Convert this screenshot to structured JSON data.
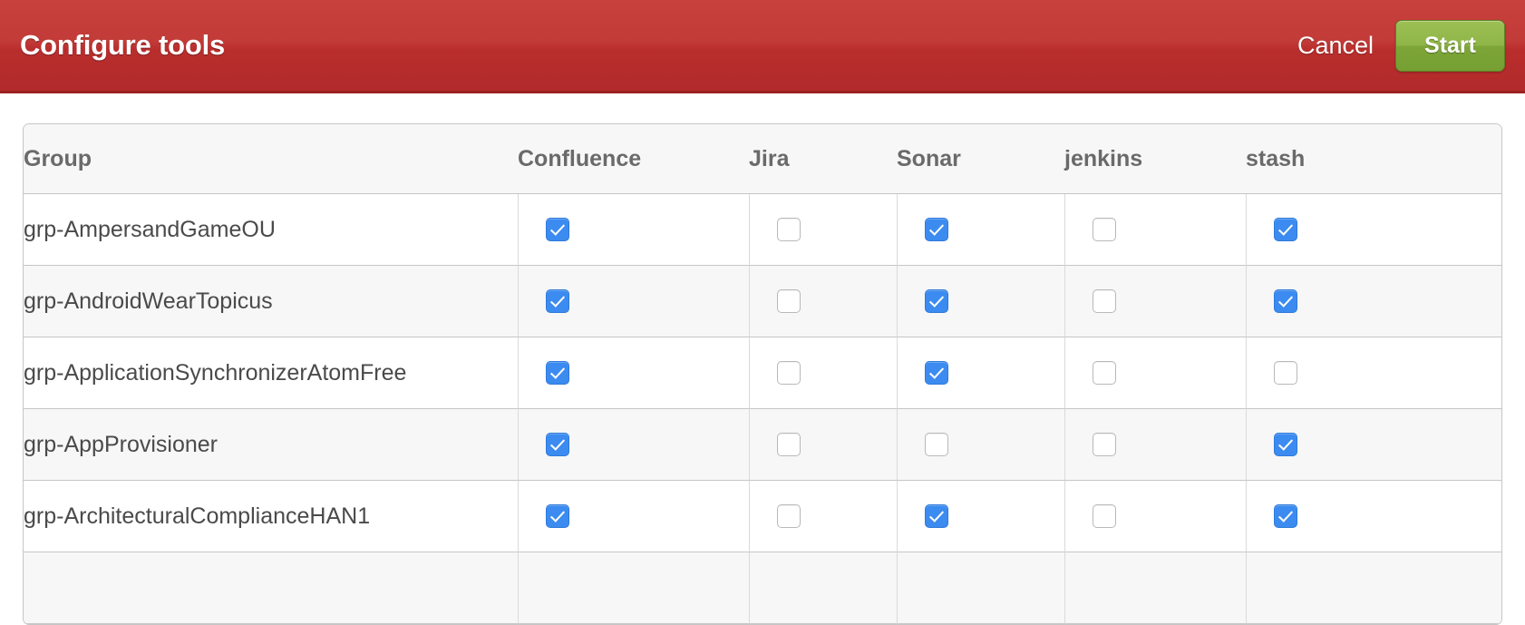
{
  "header": {
    "title": "Configure tools",
    "cancel_label": "Cancel",
    "start_label": "Start",
    "background_color_top": "#c8413c",
    "background_color_bottom": "#b22a2b",
    "start_button_color": "#8fb548"
  },
  "table": {
    "columns": [
      {
        "key": "group",
        "label": "Group"
      },
      {
        "key": "confluence",
        "label": "Confluence"
      },
      {
        "key": "jira",
        "label": "Jira"
      },
      {
        "key": "sonar",
        "label": "Sonar"
      },
      {
        "key": "jenkins",
        "label": "jenkins"
      },
      {
        "key": "stash",
        "label": "stash"
      }
    ],
    "checkbox_checked_color": "#3b8bf0",
    "rows": [
      {
        "group": "grp-AmpersandGameOU",
        "confluence": true,
        "jira": false,
        "sonar": true,
        "jenkins": false,
        "stash": true
      },
      {
        "group": "grp-AndroidWearTopicus",
        "confluence": true,
        "jira": false,
        "sonar": true,
        "jenkins": false,
        "stash": true
      },
      {
        "group": "grp-ApplicationSynchronizerAtomFree",
        "confluence": true,
        "jira": false,
        "sonar": true,
        "jenkins": false,
        "stash": false
      },
      {
        "group": "grp-AppProvisioner",
        "confluence": true,
        "jira": false,
        "sonar": false,
        "jenkins": false,
        "stash": true
      },
      {
        "group": "grp-ArchitecturalComplianceHAN1",
        "confluence": true,
        "jira": false,
        "sonar": true,
        "jenkins": false,
        "stash": true
      },
      {
        "group": "",
        "confluence": false,
        "jira": false,
        "sonar": false,
        "jenkins": false,
        "stash": false
      }
    ]
  }
}
